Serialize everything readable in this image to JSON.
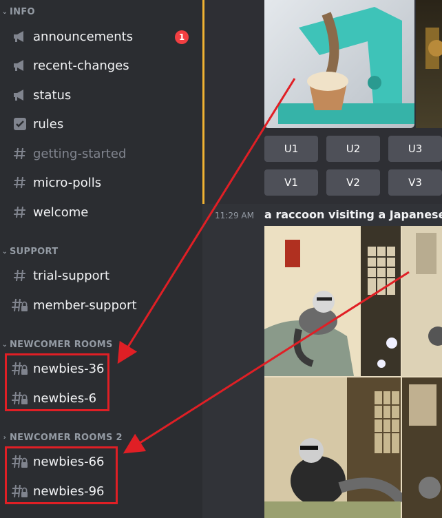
{
  "sidebar": {
    "categories": {
      "info": "INFO",
      "support": "SUPPORT",
      "newcomer": "NEWCOMER ROOMS",
      "newcomer2": "NEWCOMER ROOMS 2"
    },
    "info_channels": [
      {
        "label": "announcements",
        "icon": "megaphone-icon",
        "badge": "1"
      },
      {
        "label": "recent-changes",
        "icon": "megaphone-icon"
      },
      {
        "label": "status",
        "icon": "megaphone-icon"
      },
      {
        "label": "rules",
        "icon": "checkbox-icon"
      },
      {
        "label": "getting-started",
        "icon": "hash-icon"
      },
      {
        "label": "micro-polls",
        "icon": "hash-icon"
      },
      {
        "label": "welcome",
        "icon": "hash-icon"
      }
    ],
    "support_channels": [
      {
        "label": "trial-support",
        "icon": "hash-icon"
      },
      {
        "label": "member-support",
        "icon": "locked-hash-icon"
      }
    ],
    "newcomer_channels": [
      {
        "label": "newbies-36",
        "icon": "locked-hash-icon"
      },
      {
        "label": "newbies-6",
        "icon": "locked-hash-icon"
      }
    ],
    "newcomer2_channels": [
      {
        "label": "newbies-66",
        "icon": "locked-hash-icon"
      },
      {
        "label": "newbies-96",
        "icon": "locked-hash-icon"
      }
    ]
  },
  "chat": {
    "buttons_row1": [
      "U1",
      "U2",
      "U3"
    ],
    "buttons_row2": [
      "V1",
      "V2",
      "V3"
    ],
    "timestamp": "11:29 AM",
    "message_title": "a raccoon visiting a Japanese"
  },
  "colors": {
    "sidebar_bg": "#2b2d31",
    "main_bg": "#313338",
    "highlight_red": "#e01f25",
    "mention_accent": "#f0b232",
    "badge_red": "#f23f42",
    "button_bg": "#4e5058"
  }
}
